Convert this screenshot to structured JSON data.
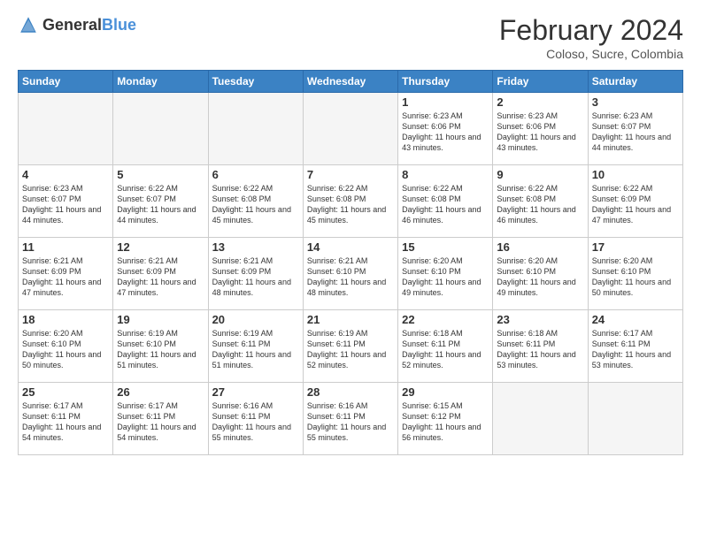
{
  "logo": {
    "general": "General",
    "blue": "Blue"
  },
  "title": "February 2024",
  "subtitle": "Coloso, Sucre, Colombia",
  "days_of_week": [
    "Sunday",
    "Monday",
    "Tuesday",
    "Wednesday",
    "Thursday",
    "Friday",
    "Saturday"
  ],
  "weeks": [
    [
      {
        "day": "",
        "empty": true
      },
      {
        "day": "",
        "empty": true
      },
      {
        "day": "",
        "empty": true
      },
      {
        "day": "",
        "empty": true
      },
      {
        "day": "1",
        "sunrise": "6:23 AM",
        "sunset": "6:06 PM",
        "daylight": "11 hours and 43 minutes."
      },
      {
        "day": "2",
        "sunrise": "6:23 AM",
        "sunset": "6:06 PM",
        "daylight": "11 hours and 43 minutes."
      },
      {
        "day": "3",
        "sunrise": "6:23 AM",
        "sunset": "6:07 PM",
        "daylight": "11 hours and 44 minutes."
      }
    ],
    [
      {
        "day": "4",
        "sunrise": "6:23 AM",
        "sunset": "6:07 PM",
        "daylight": "11 hours and 44 minutes."
      },
      {
        "day": "5",
        "sunrise": "6:22 AM",
        "sunset": "6:07 PM",
        "daylight": "11 hours and 44 minutes."
      },
      {
        "day": "6",
        "sunrise": "6:22 AM",
        "sunset": "6:08 PM",
        "daylight": "11 hours and 45 minutes."
      },
      {
        "day": "7",
        "sunrise": "6:22 AM",
        "sunset": "6:08 PM",
        "daylight": "11 hours and 45 minutes."
      },
      {
        "day": "8",
        "sunrise": "6:22 AM",
        "sunset": "6:08 PM",
        "daylight": "11 hours and 46 minutes."
      },
      {
        "day": "9",
        "sunrise": "6:22 AM",
        "sunset": "6:08 PM",
        "daylight": "11 hours and 46 minutes."
      },
      {
        "day": "10",
        "sunrise": "6:22 AM",
        "sunset": "6:09 PM",
        "daylight": "11 hours and 47 minutes."
      }
    ],
    [
      {
        "day": "11",
        "sunrise": "6:21 AM",
        "sunset": "6:09 PM",
        "daylight": "11 hours and 47 minutes."
      },
      {
        "day": "12",
        "sunrise": "6:21 AM",
        "sunset": "6:09 PM",
        "daylight": "11 hours and 47 minutes."
      },
      {
        "day": "13",
        "sunrise": "6:21 AM",
        "sunset": "6:09 PM",
        "daylight": "11 hours and 48 minutes."
      },
      {
        "day": "14",
        "sunrise": "6:21 AM",
        "sunset": "6:10 PM",
        "daylight": "11 hours and 48 minutes."
      },
      {
        "day": "15",
        "sunrise": "6:20 AM",
        "sunset": "6:10 PM",
        "daylight": "11 hours and 49 minutes."
      },
      {
        "day": "16",
        "sunrise": "6:20 AM",
        "sunset": "6:10 PM",
        "daylight": "11 hours and 49 minutes."
      },
      {
        "day": "17",
        "sunrise": "6:20 AM",
        "sunset": "6:10 PM",
        "daylight": "11 hours and 50 minutes."
      }
    ],
    [
      {
        "day": "18",
        "sunrise": "6:20 AM",
        "sunset": "6:10 PM",
        "daylight": "11 hours and 50 minutes."
      },
      {
        "day": "19",
        "sunrise": "6:19 AM",
        "sunset": "6:10 PM",
        "daylight": "11 hours and 51 minutes."
      },
      {
        "day": "20",
        "sunrise": "6:19 AM",
        "sunset": "6:11 PM",
        "daylight": "11 hours and 51 minutes."
      },
      {
        "day": "21",
        "sunrise": "6:19 AM",
        "sunset": "6:11 PM",
        "daylight": "11 hours and 52 minutes."
      },
      {
        "day": "22",
        "sunrise": "6:18 AM",
        "sunset": "6:11 PM",
        "daylight": "11 hours and 52 minutes."
      },
      {
        "day": "23",
        "sunrise": "6:18 AM",
        "sunset": "6:11 PM",
        "daylight": "11 hours and 53 minutes."
      },
      {
        "day": "24",
        "sunrise": "6:17 AM",
        "sunset": "6:11 PM",
        "daylight": "11 hours and 53 minutes."
      }
    ],
    [
      {
        "day": "25",
        "sunrise": "6:17 AM",
        "sunset": "6:11 PM",
        "daylight": "11 hours and 54 minutes."
      },
      {
        "day": "26",
        "sunrise": "6:17 AM",
        "sunset": "6:11 PM",
        "daylight": "11 hours and 54 minutes."
      },
      {
        "day": "27",
        "sunrise": "6:16 AM",
        "sunset": "6:11 PM",
        "daylight": "11 hours and 55 minutes."
      },
      {
        "day": "28",
        "sunrise": "6:16 AM",
        "sunset": "6:11 PM",
        "daylight": "11 hours and 55 minutes."
      },
      {
        "day": "29",
        "sunrise": "6:15 AM",
        "sunset": "6:12 PM",
        "daylight": "11 hours and 56 minutes."
      },
      {
        "day": "",
        "empty": true
      },
      {
        "day": "",
        "empty": true
      }
    ]
  ]
}
